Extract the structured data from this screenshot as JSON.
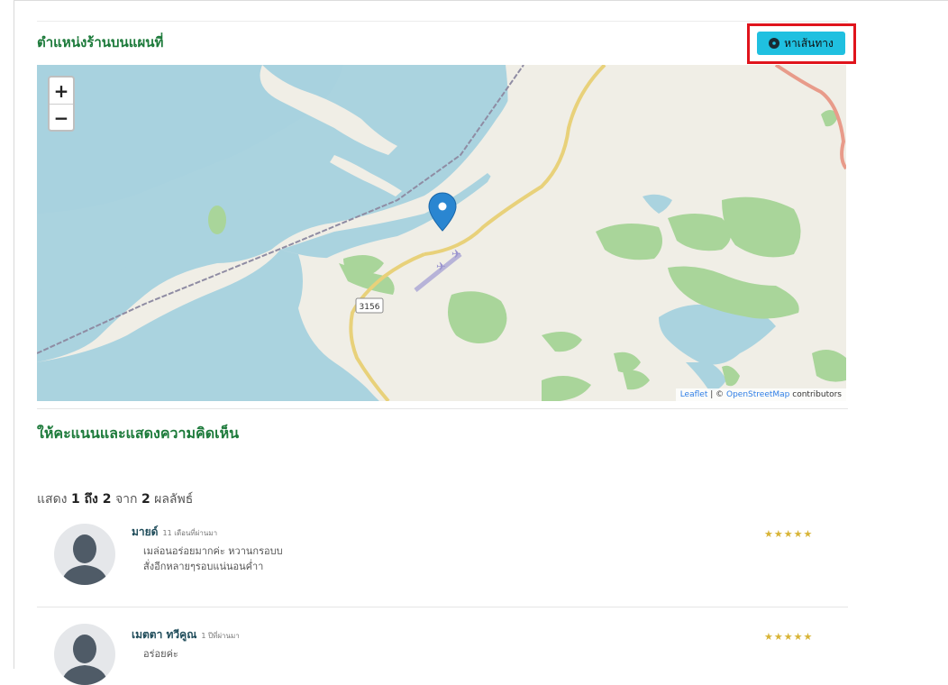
{
  "section": {
    "map_title": "ตำแหน่งร้านบนแผนที่",
    "route_button": "หาเส้นทาง"
  },
  "map": {
    "zoom_in": "+",
    "zoom_out": "−",
    "road_label": "3156",
    "attribution_leaflet": "Leaflet",
    "attribution_separator": " | © ",
    "attribution_osm": "OpenStreetMap",
    "attribution_tail": " contributors"
  },
  "reviews_section": {
    "title": "ให้คะแนนและแสดงความคิดเห็น",
    "summary_prefix": "แสดง ",
    "summary_range": "1 ถึง 2",
    "summary_mid": " จาก ",
    "summary_total": "2",
    "summary_suffix": " ผลลัพธ์"
  },
  "reviews": [
    {
      "name": "มายด์",
      "meta": "11 เดือนที่ผ่านมา",
      "line1": "เมล่อนอร่อยมากค่ะ หวานกรอบบ",
      "line2": "สั่งอีกหลายๆรอบแน่นอนค่ำา",
      "stars": "★★★★★"
    },
    {
      "name": "เมตตา ทวีคูณ",
      "meta": "1 ปีที่ผ่านมา",
      "line1": "อร่อยค่ะ",
      "stars": "★★★★★"
    }
  ],
  "colors": {
    "green_title": "#1c7a3a",
    "accent_button": "#1fc0e0",
    "highlight_border": "#e0141c",
    "water": "#aad3df",
    "land": "#f0eee6",
    "park": "#a9d59a"
  },
  "icons": [
    "compass-icon",
    "map-marker-icon",
    "airport-icon",
    "avatar-icon",
    "star-icon"
  ]
}
